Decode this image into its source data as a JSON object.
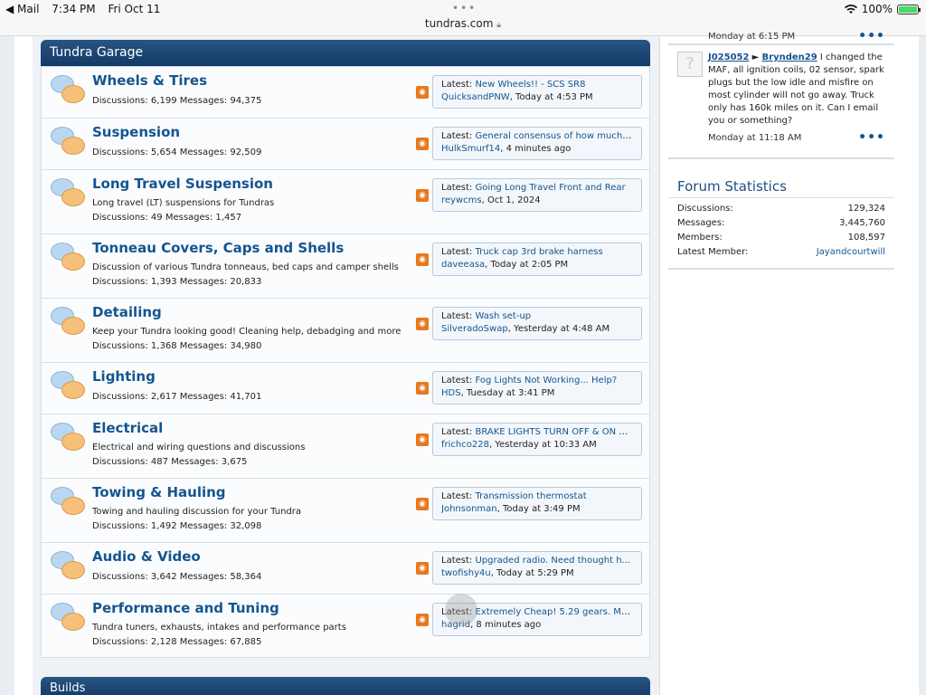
{
  "status_bar": {
    "back_app": "◀ Mail",
    "time": "7:34 PM",
    "date": "Fri Oct 11",
    "url": "tundras.com",
    "battery": "100%"
  },
  "category": {
    "title": "Tundra Garage"
  },
  "forums": [
    {
      "title": "Wheels & Tires",
      "description": "",
      "stats": "Discussions: 6,199 Messages: 94,375",
      "latest_title": "New Wheels!! - SCS SR8",
      "latest_user": "QuicksandPNW",
      "latest_time": ", Today at 4:53 PM"
    },
    {
      "title": "Suspension",
      "description": "",
      "stats": "Discussions: 5,654 Messages: 92,509",
      "latest_title": "General consensus of how much L...",
      "latest_user": "HulkSmurf14",
      "latest_time": ", 4 minutes ago"
    },
    {
      "title": "Long Travel Suspension",
      "description": "Long travel (LT) suspensions for Tundras",
      "stats": "Discussions: 49 Messages: 1,457",
      "latest_title": "Going Long Travel Front and Rear",
      "latest_user": "reywcms",
      "latest_time": ", Oct 1, 2024"
    },
    {
      "title": "Tonneau Covers, Caps and Shells",
      "description": "Discussion of various Tundra tonneaus, bed caps and camper shells",
      "stats": "Discussions: 1,393 Messages: 20,833",
      "latest_title": "Truck cap 3rd brake harness",
      "latest_user": "daveeasa",
      "latest_time": ", Today at 2:05 PM"
    },
    {
      "title": "Detailing",
      "description": "Keep your Tundra looking good! Cleaning help, debadging and more",
      "stats": "Discussions: 1,368 Messages: 34,980",
      "latest_title": "Wash set-up",
      "latest_user": "SilveradoSwap",
      "latest_time": ", Yesterday at 4:48 AM"
    },
    {
      "title": "Lighting",
      "description": "",
      "stats": "Discussions: 2,617 Messages: 41,701",
      "latest_title": "Fog Lights Not Working... Help?",
      "latest_user": "HDS",
      "latest_time": ", Tuesday at 3:41 PM"
    },
    {
      "title": "Electrical",
      "description": "Electrical and wiring questions and discussions",
      "stats": "Discussions: 487 Messages: 3,675",
      "latest_title": "BRAKE LIGHTS TURN OFF & ON R...",
      "latest_user": "frichco228",
      "latest_time": ", Yesterday at 10:33 AM"
    },
    {
      "title": "Towing & Hauling",
      "description": "Towing and hauling discussion for your Tundra",
      "stats": "Discussions: 1,492 Messages: 32,098",
      "latest_title": "Transmission thermostat",
      "latest_user": "Johnsonman",
      "latest_time": ", Today at 3:49 PM"
    },
    {
      "title": "Audio & Video",
      "description": "",
      "stats": "Discussions: 3,642 Messages: 58,364",
      "latest_title": "Upgraded radio. Need thought h...",
      "latest_user": "twofishy4u",
      "latest_time": ", Today at 5:29 PM"
    },
    {
      "title": "Performance and Tuning",
      "description": "Tundra tuners, exhausts, intakes and performance parts",
      "stats": "Discussions: 2,128 Messages: 67,885",
      "latest_title": "Extremely Cheap! 5.29 gears. Mo...",
      "latest_user": "hagrid",
      "latest_time": ", 8 minutes ago"
    }
  ],
  "latest_prefix": "Latest: ",
  "next_category": {
    "title": "Builds"
  },
  "sidebar": {
    "prev_post_time": "Monday at 6:15 PM",
    "post": {
      "user_from": "J025052",
      "arrow": "►",
      "user_to": "Brynden29",
      "text": " I changed the MAF, all ignition coils, 02 sensor, spark plugs but the low idle and misfire on most cylinder will not go away. Truck only has 160k miles on it. Can I email you or something?",
      "time": "Monday at 11:18 AM"
    },
    "more": "•••",
    "stats_title": "Forum Statistics",
    "stats": [
      {
        "label": "Discussions:",
        "value": "129,324"
      },
      {
        "label": "Messages:",
        "value": "3,445,760"
      },
      {
        "label": "Members:",
        "value": "108,597"
      },
      {
        "label": "Latest Member:",
        "value": "Jayandcourtwill"
      }
    ]
  }
}
